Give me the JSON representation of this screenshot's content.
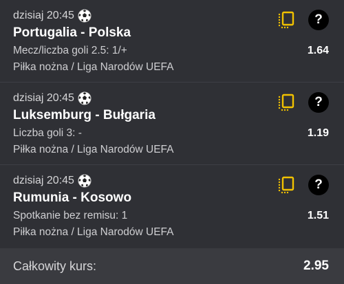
{
  "bets": [
    {
      "time": "dzisiaj 20:45",
      "match": "Portugalia - Polska",
      "market": "Mecz/liczba goli 2.5: 1/+",
      "league": "Piłka nożna / Liga Narodów UEFA",
      "odds": "1.64"
    },
    {
      "time": "dzisiaj 20:45",
      "match": "Luksemburg - Bułgaria",
      "market": "Liczba goli 3: -",
      "league": "Piłka nożna / Liga Narodów UEFA",
      "odds": "1.19"
    },
    {
      "time": "dzisiaj 20:45",
      "match": "Rumunia - Kosowo",
      "market": "Spotkanie bez remisu: 1",
      "league": "Piłka nożna / Liga Narodów UEFA",
      "odds": "1.51"
    }
  ],
  "help_symbol": "?",
  "total": {
    "label": "Całkowity kurs:",
    "value": "2.95"
  },
  "icons": {
    "sport": "soccer-ball-icon",
    "stats": "statistics-icon",
    "help": "help-icon"
  },
  "colors": {
    "background": "#2f3035",
    "accent": "#f2c200",
    "total_bar": "#3a3b40"
  }
}
